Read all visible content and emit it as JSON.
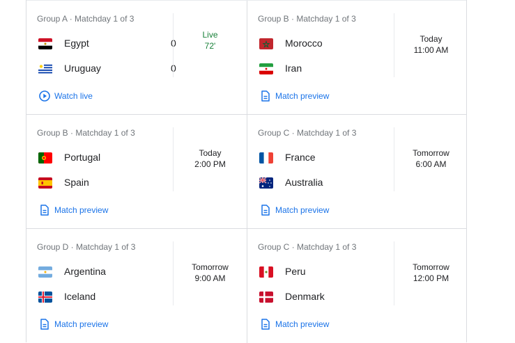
{
  "matches": [
    {
      "group": "Group A · Matchday 1 of 3",
      "team1": {
        "name": "Egypt",
        "flag": "egypt-flag",
        "score": "0"
      },
      "team2": {
        "name": "Uruguay",
        "flag": "uruguay-flag",
        "score": "0"
      },
      "status_line1": "Live",
      "status_line2": "72'",
      "live": true,
      "link_label": "Watch live",
      "link_icon": "play-circle-icon"
    },
    {
      "group": "Group B · Matchday 1 of 3",
      "team1": {
        "name": "Morocco",
        "flag": "morocco-flag"
      },
      "team2": {
        "name": "Iran",
        "flag": "iran-flag"
      },
      "status_line1": "Today",
      "status_line2": "11:00 AM",
      "link_label": "Match preview",
      "link_icon": "document-icon"
    },
    {
      "group": "Group B · Matchday 1 of 3",
      "team1": {
        "name": "Portugal",
        "flag": "portugal-flag"
      },
      "team2": {
        "name": "Spain",
        "flag": "spain-flag"
      },
      "status_line1": "Today",
      "status_line2": "2:00 PM",
      "link_label": "Match preview",
      "link_icon": "document-icon"
    },
    {
      "group": "Group C · Matchday 1 of 3",
      "team1": {
        "name": "France",
        "flag": "france-flag"
      },
      "team2": {
        "name": "Australia",
        "flag": "australia-flag"
      },
      "status_line1": "Tomorrow",
      "status_line2": "6:00 AM",
      "link_label": "Match preview",
      "link_icon": "document-icon"
    },
    {
      "group": "Group D · Matchday 1 of 3",
      "team1": {
        "name": "Argentina",
        "flag": "argentina-flag"
      },
      "team2": {
        "name": "Iceland",
        "flag": "iceland-flag"
      },
      "status_line1": "Tomorrow",
      "status_line2": "9:00 AM",
      "link_label": "Match preview",
      "link_icon": "document-icon"
    },
    {
      "group": "Group C · Matchday 1 of 3",
      "team1": {
        "name": "Peru",
        "flag": "peru-flag"
      },
      "team2": {
        "name": "Denmark",
        "flag": "denmark-flag"
      },
      "status_line1": "Tomorrow",
      "status_line2": "12:00 PM",
      "link_label": "Match preview",
      "link_icon": "document-icon"
    }
  ],
  "colors": {
    "link": "#1a73e8",
    "live": "#188038",
    "muted": "#70757a",
    "divider": "#dadce0"
  }
}
